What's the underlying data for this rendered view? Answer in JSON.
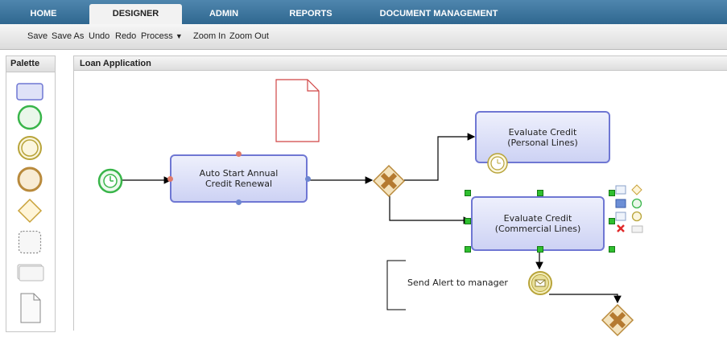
{
  "tabs": [
    {
      "label": "HOME"
    },
    {
      "label": "DESIGNER"
    },
    {
      "label": "ADMIN"
    },
    {
      "label": "REPORTS"
    },
    {
      "label": "DOCUMENT MANAGEMENT"
    }
  ],
  "active_tab": "DESIGNER",
  "toolbar": {
    "save": "Save",
    "save_as": "Save As",
    "undo": "Undo",
    "redo": "Redo",
    "process": "Process",
    "zoom_in": "Zoom In",
    "zoom_out": "Zoom Out"
  },
  "palette": {
    "title": "Palette",
    "tools": [
      "task",
      "start-event",
      "intermediate-event",
      "end-event",
      "gateway",
      "subprocess",
      "text-annotation",
      "data-object"
    ]
  },
  "canvas": {
    "title": "Loan Application",
    "tasks": {
      "auto_start": "Auto Start Annual Credit Renewal",
      "personal": "Evaluate Credit (Personal Lines)",
      "commercial": "Evaluate Credit (Commercial Lines)"
    },
    "annotation": "Send Alert to manager"
  },
  "colors": {
    "tab_bar": "#3b76a0",
    "task_border": "#6f77d3",
    "task_fill": "#dfe2f8",
    "start_event": "#39b54a",
    "gateway": "#c9913e",
    "document_outline": "#d04545",
    "selection_handle": "#2fbf2f"
  }
}
